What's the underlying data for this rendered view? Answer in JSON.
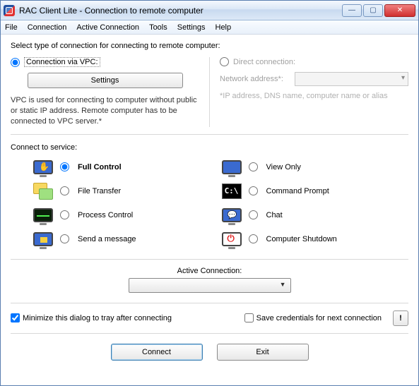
{
  "window": {
    "title": "RAC Client Lite - Connection to remote computer"
  },
  "menu": {
    "file": "File",
    "connection": "Connection",
    "active_connection": "Active Connection",
    "tools": "Tools",
    "settings": "Settings",
    "help": "Help"
  },
  "intro": "Select type of connection for connecting to remote computer:",
  "left": {
    "radio_label": "Connection via VPC:",
    "settings_btn": "Settings",
    "desc": "VPC is used for connecting to computer without public or static IP address. Remote computer has to be connected to VPC server.*"
  },
  "right": {
    "radio_label": "Direct connection:",
    "addr_label": "Network address*:",
    "hint": "*IP address, DNS name, computer name or alias"
  },
  "connect_to_label": "Connect to service:",
  "services": {
    "full_control": "Full Control",
    "view_only": "View Only",
    "file_transfer": "File Transfer",
    "command_prompt": "Command Prompt",
    "process_control": "Process Control",
    "chat": "Chat",
    "send_message": "Send a message",
    "shutdown": "Computer Shutdown"
  },
  "active_conn_label": "Active Connection:",
  "checks": {
    "minimize": "Minimize this dialog to tray after connecting",
    "save_creds": "Save credentials for next connection"
  },
  "info_btn": "!",
  "buttons": {
    "connect": "Connect",
    "exit": "Exit"
  },
  "cmd_icon_text": "C:\\"
}
